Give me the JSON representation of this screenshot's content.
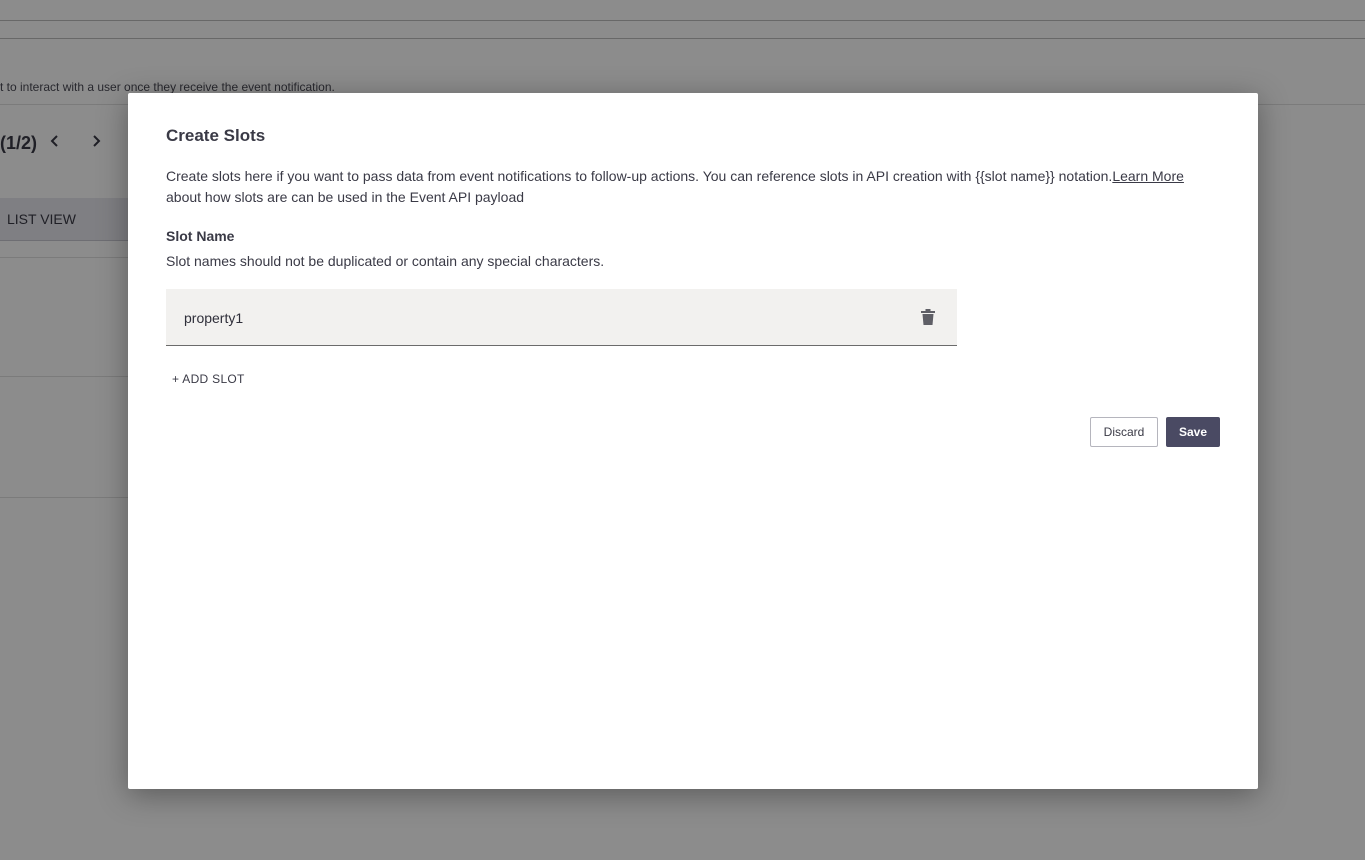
{
  "background": {
    "description_fragment": "t to interact with a user once they receive the event notification.",
    "pager_label": "(1/2)",
    "prev_icon": "chevron-left-icon",
    "next_icon": "chevron-right-icon",
    "list_view_label": "LIST VIEW"
  },
  "modal": {
    "title": "Create Slots",
    "description_prefix": "Create slots here if you want to pass data from event notifications to follow-up actions. You can reference slots in API creation with {{slot name}} notation.",
    "learn_more_label": "Learn More",
    "description_suffix": " about how slots are can be used in the Event API payload",
    "slot_name_label": "Slot Name",
    "slot_name_hint": "Slot names should not be duplicated or contain any special characters.",
    "slots": [
      {
        "value": "property1",
        "delete_icon": "trash-icon"
      }
    ],
    "add_slot_label": "+ ADD SLOT",
    "discard_label": "Discard",
    "save_label": "Save"
  },
  "colors": {
    "overlay": "#000000",
    "primary_button": "#4a4a63",
    "field_background": "#f2f1ef"
  }
}
